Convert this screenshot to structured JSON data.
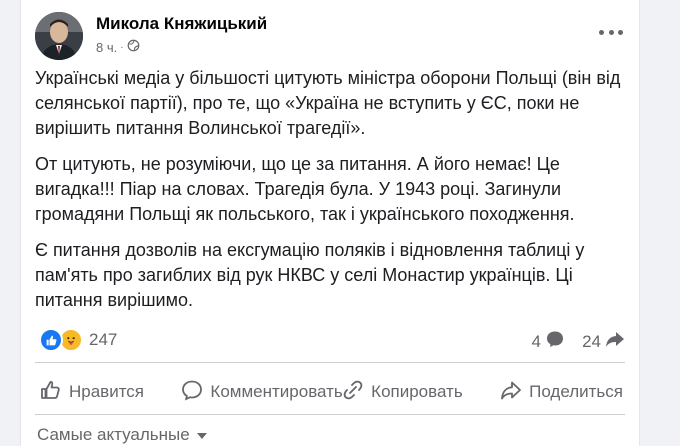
{
  "post": {
    "author": "Микола Княжицький",
    "time": "8 ч.",
    "privacy_icon": "globe-icon",
    "paragraphs": [
      "Українські медіа у більшості цитують міністра оборони Польщі (він від селянської партії), про те, що «Україна не вступить у ЄС, поки не вирішить питання Волинської трагедії».",
      "От цитують, не розуміючи, що це за питання. А його немає! Це вигадка!!! Піар на словах. Трагедія була. У 1943 році. Загинули громадяни Польщі як польського, так і українського походження.",
      "Є питання дозволів на ексгумацію поляків і відновлення таблиці у пам'ять про загиблих від рук НКВС у селі Монастир українців. Ці питання вирішимо."
    ]
  },
  "stats": {
    "reactions_count": "247",
    "reaction_icons": [
      "like-icon",
      "care-icon"
    ],
    "comments_count": "4",
    "shares_count": "24"
  },
  "actions": {
    "like": "Нравится",
    "comment": "Комментировать",
    "copy": "Копировать",
    "share": "Поделиться"
  },
  "comments_sort": "Самые актуальные",
  "colors": {
    "like_blue": "#1877f2",
    "care_yellow": "#f7b928",
    "secondary_text": "#65676b",
    "background": "#f0f2f5"
  }
}
